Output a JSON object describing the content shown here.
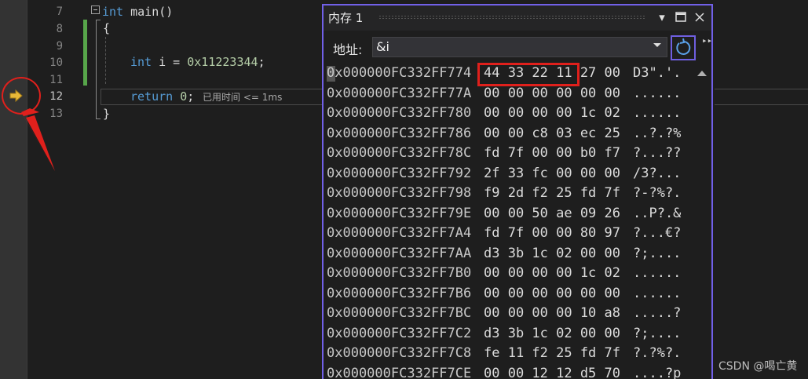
{
  "editor": {
    "line_numbers": [
      "7",
      "8",
      "9",
      "10",
      "11",
      "12",
      "13"
    ],
    "current_line": "12",
    "lines": {
      "l7_keyword": "int",
      "l7_rest": " main()",
      "l8": "{",
      "l10_keyword": "int",
      "l10_mid": " i = ",
      "l10_num": "0x11223344",
      "l10_end": ";",
      "l12_keyword": "return",
      "l12_num": "0",
      "l12_end": ";",
      "l13": "}"
    },
    "perf_tip": "已用时间 <= 1ms"
  },
  "memory_window": {
    "title": "内存 1",
    "address_label": "地址:",
    "address_value": "&i",
    "rows": [
      {
        "addr": "0x000000FC332FF774",
        "bytes": "44 33 22 11 27 00",
        "chars": "D3\".'."
      },
      {
        "addr": "0x000000FC332FF77A",
        "bytes": "00 00 00 00 00 00",
        "chars": "......"
      },
      {
        "addr": "0x000000FC332FF780",
        "bytes": "00 00 00 00 1c 02",
        "chars": "......"
      },
      {
        "addr": "0x000000FC332FF786",
        "bytes": "00 00 c8 03 ec 25",
        "chars": "..?.?%"
      },
      {
        "addr": "0x000000FC332FF78C",
        "bytes": "fd 7f 00 00 b0 f7",
        "chars": "?...??"
      },
      {
        "addr": "0x000000FC332FF792",
        "bytes": "2f 33 fc 00 00 00",
        "chars": "/3?..."
      },
      {
        "addr": "0x000000FC332FF798",
        "bytes": "f9 2d f2 25 fd 7f",
        "chars": "?-?%?."
      },
      {
        "addr": "0x000000FC332FF79E",
        "bytes": "00 00 50 ae 09 26",
        "chars": "..P?.&"
      },
      {
        "addr": "0x000000FC332FF7A4",
        "bytes": "fd 7f 00 00 80 97",
        "chars": "?...€?"
      },
      {
        "addr": "0x000000FC332FF7AA",
        "bytes": "d3 3b 1c 02 00 00",
        "chars": "?;...."
      },
      {
        "addr": "0x000000FC332FF7B0",
        "bytes": "00 00 00 00 1c 02",
        "chars": "......"
      },
      {
        "addr": "0x000000FC332FF7B6",
        "bytes": "00 00 00 00 00 00",
        "chars": "......"
      },
      {
        "addr": "0x000000FC332FF7BC",
        "bytes": "00 00 00 00 10 a8",
        "chars": ".....?"
      },
      {
        "addr": "0x000000FC332FF7C2",
        "bytes": "d3 3b 1c 02 00 00",
        "chars": "?;...."
      },
      {
        "addr": "0x000000FC332FF7C8",
        "bytes": "fe 11 f2 25 fd 7f",
        "chars": "?.?%?."
      },
      {
        "addr": "0x000000FC332FF7CE",
        "bytes": "00 00 12 12 d5 70",
        "chars": "....?p"
      }
    ]
  },
  "watermark": "CSDN @喝亡黄",
  "colors": {
    "accent": "#7160e8",
    "annotation": "#e0201c",
    "keyword": "#569cd6",
    "number": "#b5cea8",
    "changed_line": "#57a64a"
  },
  "icons": {
    "execution_pointer": "arrow-right-icon",
    "refresh": "refresh-icon",
    "dropdown": "chevron-down-icon",
    "close": "close-icon",
    "maximize": "maximize-icon",
    "options": "chevron-down-icon"
  }
}
